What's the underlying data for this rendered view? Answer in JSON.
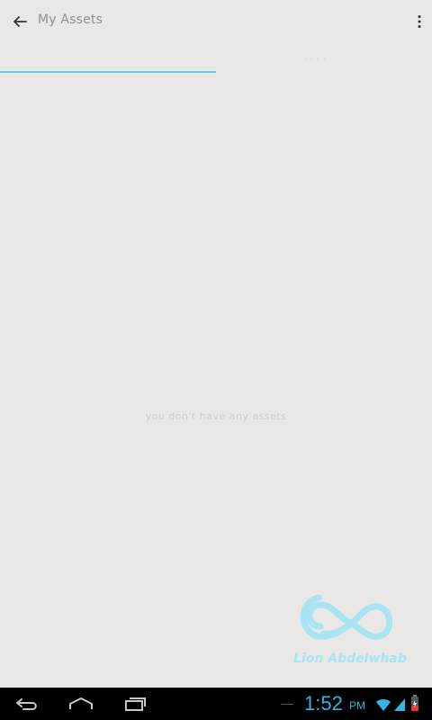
{
  "app_bar": {
    "title": "My Assets",
    "back_icon": "arrow-left-icon",
    "overflow_icon": "more-vertical-icon"
  },
  "tabs": [
    {
      "label": "",
      "selected": true
    },
    {
      "label": "· · · ·",
      "selected": false
    }
  ],
  "colors": {
    "background": "#e9e8e6",
    "accent": "#4fd3e6",
    "title_text": "#8f8f8f",
    "system_bar": "#000000",
    "clock": "#33b5e5",
    "watermark": "#a8e4f2"
  },
  "content": {
    "empty_message": "you don't have any assets"
  },
  "watermark": {
    "text": "Lion Abdelwhab",
    "icon": "infinity-loop-logo"
  },
  "system_bar": {
    "time": "1:52",
    "ampm": "PM",
    "icons": [
      "back-icon",
      "home-icon",
      "recent-apps-icon",
      "wifi-icon",
      "signal-icon",
      "battery-icon"
    ]
  }
}
